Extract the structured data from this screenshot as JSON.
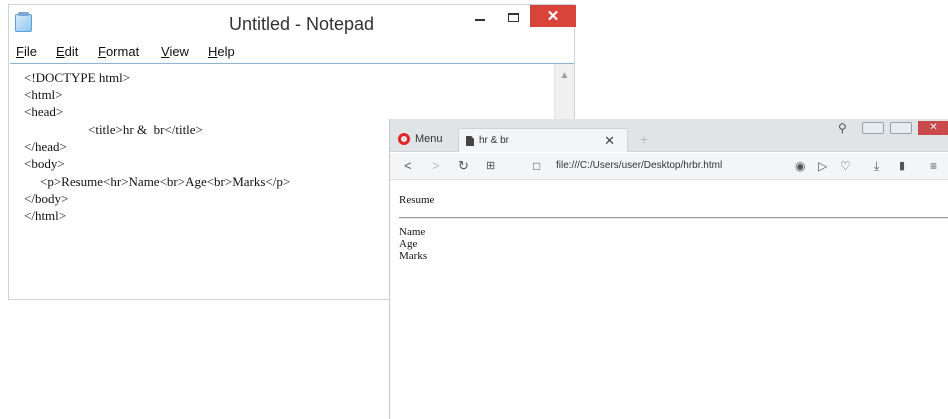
{
  "notepad": {
    "title": "Untitled - Notepad",
    "close_glyph": "✕",
    "menu": [
      "File",
      "Edit",
      "Format",
      "View",
      "Help"
    ],
    "code_lines": [
      "<!DOCTYPE html>",
      "<html>",
      "<head>",
      "<title>hr &  br</title>",
      "</head>",
      "<body>",
      "<p>Resume<hr>Name<br>Age<br>Marks</p>",
      "</body>",
      "</html>"
    ]
  },
  "browser": {
    "menu_label": "Menu",
    "tab": {
      "label": "hr & br",
      "close_glyph": "✕"
    },
    "url": "file:///C:/Users/user/Desktop/hrbr.html",
    "page": {
      "heading": "Resume",
      "lines": [
        "Name",
        "Age",
        "Marks"
      ]
    }
  },
  "colors": {
    "close_red": "#d9443a",
    "opera_red": "#e0262a"
  }
}
